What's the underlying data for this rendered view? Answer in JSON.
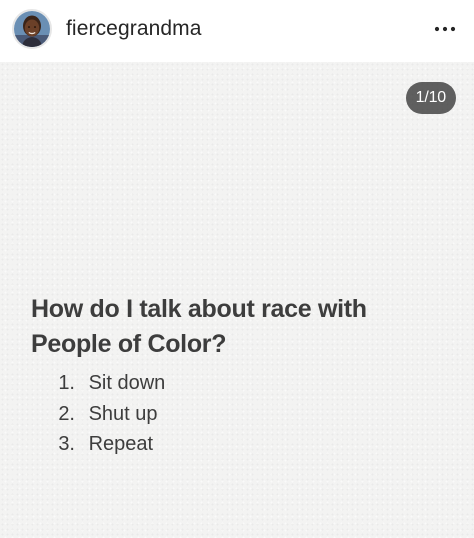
{
  "header": {
    "username": "fiercegrandma",
    "avatar_icon": "profile-photo",
    "more_icon": "more-options-icon"
  },
  "slide": {
    "counter": "1/10",
    "question": "How do I talk about race with People of Color?",
    "items": [
      {
        "number": "1.",
        "text": "Sit down"
      },
      {
        "number": "2.",
        "text": "Shut up"
      },
      {
        "number": "3.",
        "text": "Repeat"
      }
    ],
    "background_color": "#f3f3f2",
    "text_color": "#3d3d3d"
  }
}
